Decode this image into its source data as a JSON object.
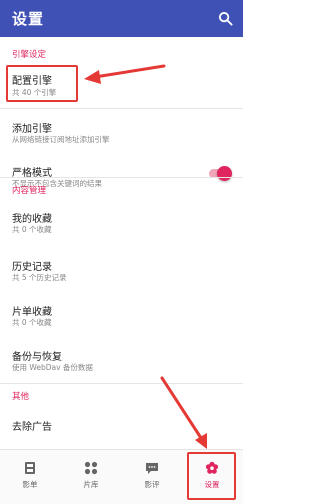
{
  "appbar": {
    "title": "设置"
  },
  "sections": {
    "engine": "引擎设定",
    "content": "内容管理",
    "other": "其他"
  },
  "items": {
    "config_engine": {
      "title": "配置引擎",
      "subtitle": "共 40 个引擎"
    },
    "add_engine": {
      "title": "添加引擎",
      "subtitle": "从网络链接订阅地址添加引擎"
    },
    "strict_mode": {
      "title": "严格模式",
      "subtitle": "不显示不包含关键词的结果",
      "enabled": true
    },
    "favorites": {
      "title": "我的收藏",
      "subtitle": "共 0 个收藏"
    },
    "history": {
      "title": "历史记录",
      "subtitle": "共 5 个历史记录"
    },
    "playlist": {
      "title": "片单收藏",
      "subtitle": "共 0 个收藏"
    },
    "backup": {
      "title": "备份与恢复",
      "subtitle": "使用 WebDav 备份数据"
    },
    "remove_ads": {
      "title": "去除广告"
    }
  },
  "nav": {
    "tabs": [
      {
        "label": "影单",
        "icon": "film-icon"
      },
      {
        "label": "片库",
        "icon": "grid-icon"
      },
      {
        "label": "影评",
        "icon": "comment-icon"
      },
      {
        "label": "设置",
        "icon": "settings-flower-icon",
        "active": true
      }
    ]
  },
  "colors": {
    "primary": "#3f51b5",
    "accent": "#e0245e",
    "annotation": "#e53935"
  }
}
